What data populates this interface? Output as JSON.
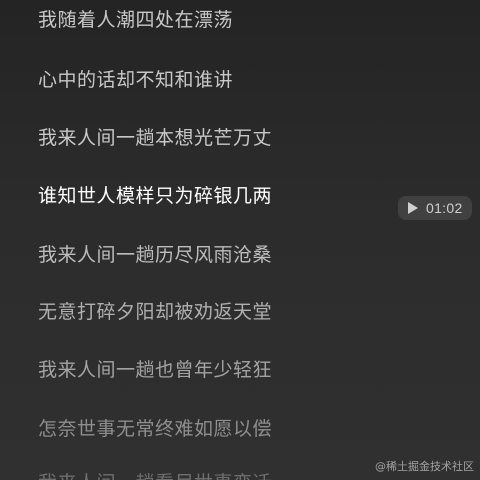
{
  "lyrics": {
    "lines": [
      {
        "text": "我随着人潮四处在漂荡",
        "color": "#c8c8c8"
      },
      {
        "text": "心中的话却不知和谁讲",
        "color": "#c8c8c8"
      },
      {
        "text": "我来人间一趟本想光芒万丈",
        "color": "#c8c8c8"
      },
      {
        "text": "谁知世人模样只为碎银几两",
        "color": "#ffffff"
      },
      {
        "text": "我来人间一趟历尽风雨沧桑",
        "color": "#bdbdbd"
      },
      {
        "text": "无意打碎夕阳却被劝返天堂",
        "color": "#b0b0b0"
      },
      {
        "text": "我来人间一趟也曾年少轻狂",
        "color": "#a3a3a3"
      },
      {
        "text": "怎奈世事无常终难如愿以偿",
        "color": "#8e8e8e"
      },
      {
        "text": "我来人间一趟看尽世事变迁",
        "color": "#6e6e6e"
      }
    ]
  },
  "seek_pill": {
    "icon": "play-icon",
    "time": "01:02"
  },
  "watermark": "@稀土掘金技术社区"
}
